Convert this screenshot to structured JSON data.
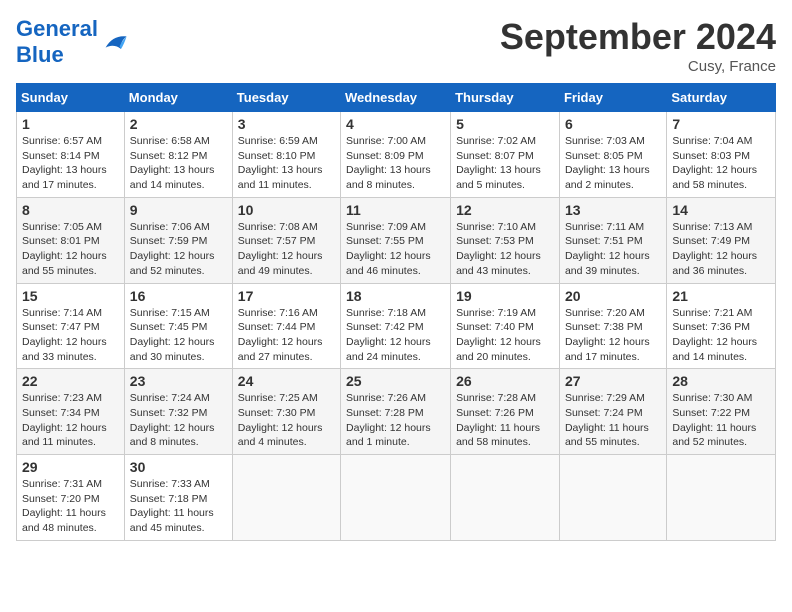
{
  "header": {
    "logo_general": "General",
    "logo_blue": "Blue",
    "month_title": "September 2024",
    "location": "Cusy, France"
  },
  "calendar": {
    "days_of_week": [
      "Sunday",
      "Monday",
      "Tuesday",
      "Wednesday",
      "Thursday",
      "Friday",
      "Saturday"
    ],
    "weeks": [
      [
        {
          "num": "",
          "empty": true
        },
        {
          "num": "",
          "empty": true
        },
        {
          "num": "",
          "empty": true
        },
        {
          "num": "",
          "empty": true
        },
        {
          "num": "5",
          "sunrise": "7:02 AM",
          "sunset": "8:07 PM",
          "daylight": "13 hours and 5 minutes."
        },
        {
          "num": "6",
          "sunrise": "7:03 AM",
          "sunset": "8:05 PM",
          "daylight": "13 hours and 2 minutes."
        },
        {
          "num": "7",
          "sunrise": "7:04 AM",
          "sunset": "8:03 PM",
          "daylight": "12 hours and 58 minutes."
        }
      ],
      [
        {
          "num": "1",
          "sunrise": "6:57 AM",
          "sunset": "8:14 PM",
          "daylight": "13 hours and 17 minutes."
        },
        {
          "num": "2",
          "sunrise": "6:58 AM",
          "sunset": "8:12 PM",
          "daylight": "13 hours and 14 minutes."
        },
        {
          "num": "3",
          "sunrise": "6:59 AM",
          "sunset": "8:10 PM",
          "daylight": "13 hours and 11 minutes."
        },
        {
          "num": "4",
          "sunrise": "7:00 AM",
          "sunset": "8:09 PM",
          "daylight": "13 hours and 8 minutes."
        },
        {
          "num": "5",
          "sunrise": "7:02 AM",
          "sunset": "8:07 PM",
          "daylight": "13 hours and 5 minutes."
        },
        {
          "num": "6",
          "sunrise": "7:03 AM",
          "sunset": "8:05 PM",
          "daylight": "13 hours and 2 minutes."
        },
        {
          "num": "7",
          "sunrise": "7:04 AM",
          "sunset": "8:03 PM",
          "daylight": "12 hours and 58 minutes."
        }
      ],
      [
        {
          "num": "8",
          "sunrise": "7:05 AM",
          "sunset": "8:01 PM",
          "daylight": "12 hours and 55 minutes."
        },
        {
          "num": "9",
          "sunrise": "7:06 AM",
          "sunset": "7:59 PM",
          "daylight": "12 hours and 52 minutes."
        },
        {
          "num": "10",
          "sunrise": "7:08 AM",
          "sunset": "7:57 PM",
          "daylight": "12 hours and 49 minutes."
        },
        {
          "num": "11",
          "sunrise": "7:09 AM",
          "sunset": "7:55 PM",
          "daylight": "12 hours and 46 minutes."
        },
        {
          "num": "12",
          "sunrise": "7:10 AM",
          "sunset": "7:53 PM",
          "daylight": "12 hours and 43 minutes."
        },
        {
          "num": "13",
          "sunrise": "7:11 AM",
          "sunset": "7:51 PM",
          "daylight": "12 hours and 39 minutes."
        },
        {
          "num": "14",
          "sunrise": "7:13 AM",
          "sunset": "7:49 PM",
          "daylight": "12 hours and 36 minutes."
        }
      ],
      [
        {
          "num": "15",
          "sunrise": "7:14 AM",
          "sunset": "7:47 PM",
          "daylight": "12 hours and 33 minutes."
        },
        {
          "num": "16",
          "sunrise": "7:15 AM",
          "sunset": "7:45 PM",
          "daylight": "12 hours and 30 minutes."
        },
        {
          "num": "17",
          "sunrise": "7:16 AM",
          "sunset": "7:44 PM",
          "daylight": "12 hours and 27 minutes."
        },
        {
          "num": "18",
          "sunrise": "7:18 AM",
          "sunset": "7:42 PM",
          "daylight": "12 hours and 24 minutes."
        },
        {
          "num": "19",
          "sunrise": "7:19 AM",
          "sunset": "7:40 PM",
          "daylight": "12 hours and 20 minutes."
        },
        {
          "num": "20",
          "sunrise": "7:20 AM",
          "sunset": "7:38 PM",
          "daylight": "12 hours and 17 minutes."
        },
        {
          "num": "21",
          "sunrise": "7:21 AM",
          "sunset": "7:36 PM",
          "daylight": "12 hours and 14 minutes."
        }
      ],
      [
        {
          "num": "22",
          "sunrise": "7:23 AM",
          "sunset": "7:34 PM",
          "daylight": "12 hours and 11 minutes."
        },
        {
          "num": "23",
          "sunrise": "7:24 AM",
          "sunset": "7:32 PM",
          "daylight": "12 hours and 8 minutes."
        },
        {
          "num": "24",
          "sunrise": "7:25 AM",
          "sunset": "7:30 PM",
          "daylight": "12 hours and 4 minutes."
        },
        {
          "num": "25",
          "sunrise": "7:26 AM",
          "sunset": "7:28 PM",
          "daylight": "12 hours and 1 minute."
        },
        {
          "num": "26",
          "sunrise": "7:28 AM",
          "sunset": "7:26 PM",
          "daylight": "11 hours and 58 minutes."
        },
        {
          "num": "27",
          "sunrise": "7:29 AM",
          "sunset": "7:24 PM",
          "daylight": "11 hours and 55 minutes."
        },
        {
          "num": "28",
          "sunrise": "7:30 AM",
          "sunset": "7:22 PM",
          "daylight": "11 hours and 52 minutes."
        }
      ],
      [
        {
          "num": "29",
          "sunrise": "7:31 AM",
          "sunset": "7:20 PM",
          "daylight": "11 hours and 48 minutes."
        },
        {
          "num": "30",
          "sunrise": "7:33 AM",
          "sunset": "7:18 PM",
          "daylight": "11 hours and 45 minutes."
        },
        {
          "num": "",
          "empty": true
        },
        {
          "num": "",
          "empty": true
        },
        {
          "num": "",
          "empty": true
        },
        {
          "num": "",
          "empty": true
        },
        {
          "num": "",
          "empty": true
        }
      ]
    ]
  }
}
